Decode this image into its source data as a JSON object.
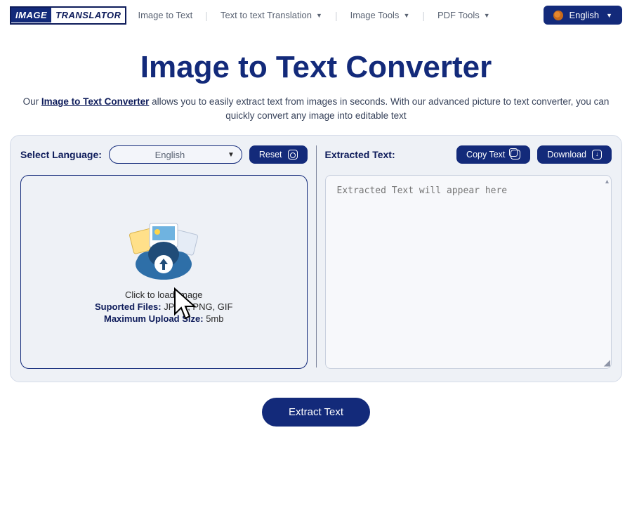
{
  "nav": {
    "logo_left": "IMAGE",
    "logo_right": "TRANSLATOR",
    "items": [
      {
        "label": "Image to Text",
        "has_dropdown": false
      },
      {
        "label": "Text to text Translation",
        "has_dropdown": true
      },
      {
        "label": "Image Tools",
        "has_dropdown": true
      },
      {
        "label": "PDF Tools",
        "has_dropdown": true
      }
    ],
    "lang_button": "English"
  },
  "title": "Image to Text Converter",
  "subtitle_prefix": "Our ",
  "subtitle_link": "Image to Text Converter",
  "subtitle_rest": " allows you to easily extract text from images in seconds. With our advanced picture to text converter, you can quickly convert any image into editable text",
  "left": {
    "select_language_label": "Select Language:",
    "language_value": "English",
    "reset_label": "Reset",
    "dropzone": {
      "line1": "Click to load Image",
      "supported_label": "Suported Files:",
      "supported_value": " JPEG, PNG, GIF",
      "max_label": "Maximum Upload Size:",
      "max_value": " 5mb"
    }
  },
  "right": {
    "extracted_label": "Extracted Text:",
    "copy_label": "Copy Text",
    "download_label": "Download",
    "output_placeholder": "Extracted Text will appear here"
  },
  "extract_button": "Extract Text",
  "colors": {
    "primary": "#132a7a",
    "panel_bg": "#eef1f6",
    "text_muted": "#5a6373"
  }
}
